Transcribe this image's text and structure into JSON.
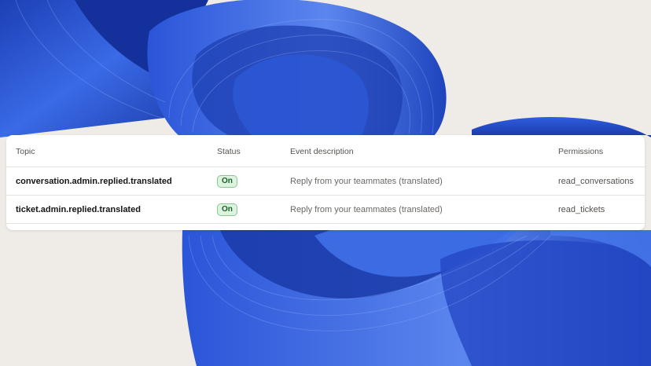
{
  "table": {
    "columns": {
      "topic": "Topic",
      "status": "Status",
      "description": "Event description",
      "permissions": "Permissions"
    },
    "rows": [
      {
        "topic": "conversation.admin.replied.translated",
        "status": "On",
        "description": "Reply from your teammates (translated)",
        "permissions": "read_conversations"
      },
      {
        "topic": "ticket.admin.replied.translated",
        "status": "On",
        "description": "Reply from your teammates (translated)",
        "permissions": "read_tickets"
      }
    ]
  },
  "colors": {
    "background": "#efebe6",
    "ribbon_blue": "#2753d6",
    "status_on_bg": "#ddf3df",
    "status_on_border": "#86c98d"
  }
}
